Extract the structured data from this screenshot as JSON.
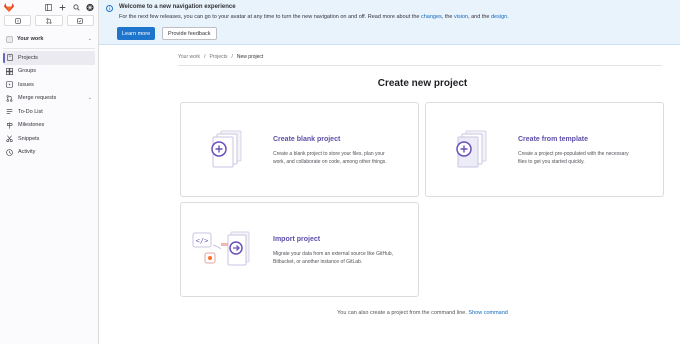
{
  "sidebar": {
    "context_label": "Your work",
    "items": [
      {
        "label": "Projects",
        "icon": "project-icon"
      },
      {
        "label": "Groups",
        "icon": "group-icon"
      },
      {
        "label": "Issues",
        "icon": "issues-icon"
      },
      {
        "label": "Merge requests",
        "icon": "merge-request-icon"
      },
      {
        "label": "To-Do List",
        "icon": "todo-icon"
      },
      {
        "label": "Milestones",
        "icon": "milestone-icon"
      },
      {
        "label": "Snippets",
        "icon": "snippet-icon"
      },
      {
        "label": "Activity",
        "icon": "activity-icon"
      }
    ]
  },
  "banner": {
    "title": "Welcome to a new navigation experience",
    "text_before": "For the next few releases, you can go to your avatar at any time to turn the new navigation on and off. Read more about the ",
    "link_changes": "changes",
    "sep1": ", the ",
    "link_vision": "vision",
    "sep2": ", and the ",
    "link_design": "design",
    "text_end": ".",
    "learn_more": "Learn more",
    "provide_feedback": "Provide feedback"
  },
  "breadcrumb": {
    "items": [
      "Your work",
      "Projects",
      "New project"
    ],
    "separator": "/"
  },
  "page_title": "Create new project",
  "cards": {
    "blank": {
      "title": "Create blank project",
      "desc1": "Create a blank project to store your files, plan your",
      "desc2": "work, and collaborate on code, among other things."
    },
    "template": {
      "title": "Create from template",
      "desc1": "Create a project pre-populated with the necessary",
      "desc2": "files to get you started quickly."
    },
    "import": {
      "title": "Import project",
      "desc1": "Migrate your data from an external source like GitHub,",
      "desc2": "Bitbucket, or another instance of GitLab."
    }
  },
  "footer": {
    "text": "You can also create a project from the command line.",
    "link": "Show command"
  },
  "colors": {
    "accent_purple": "#6b4fbb",
    "primary_blue": "#1f75cb",
    "link_blue": "#1068bf",
    "banner_bg": "#e9f3fc"
  }
}
